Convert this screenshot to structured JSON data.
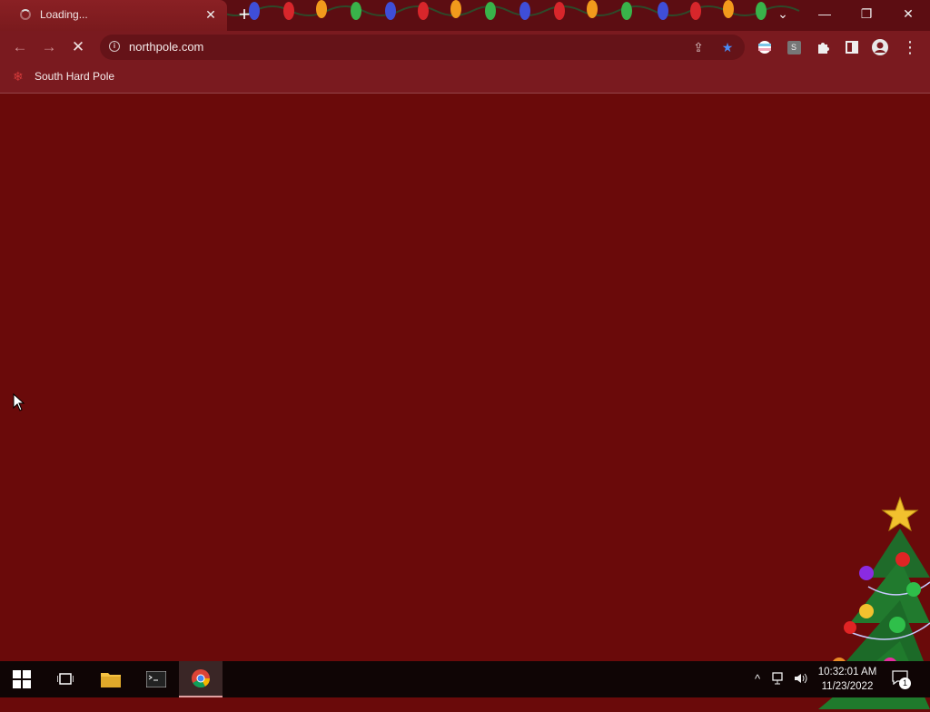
{
  "browser": {
    "tab": {
      "title": "Loading...",
      "close_label": "✕"
    },
    "new_tab_label": "+",
    "window_controls": {
      "tab_search": "⌄",
      "minimize": "—",
      "restore": "❐",
      "close": "✕"
    },
    "nav": {
      "back": "←",
      "forward": "→",
      "stop": "✕"
    },
    "address_bar": {
      "url": "northpole.com",
      "info": "i"
    },
    "omnibox_actions": {
      "share": "⇪",
      "bookmark": "★"
    },
    "extensions": [
      "ext-flag-icon",
      "ext-s-icon",
      "puzzle-icon",
      "side-panel-icon",
      "profile-icon",
      "menu-icon"
    ],
    "extension_s_label": "S",
    "menu_label": "⋮",
    "bookmarks": [
      {
        "label": "South Hard Pole",
        "icon": "snowflake-icon"
      }
    ]
  },
  "page": {
    "background": "#6a0a0a"
  },
  "taskbar": {
    "apps": [
      "windows-start",
      "task-view",
      "file-explorer",
      "terminal",
      "chrome"
    ],
    "tray": {
      "chevron": "^"
    },
    "clock": {
      "time": "10:32:01 AM",
      "date": "11/23/2022"
    },
    "notifications": {
      "count": "1"
    }
  }
}
